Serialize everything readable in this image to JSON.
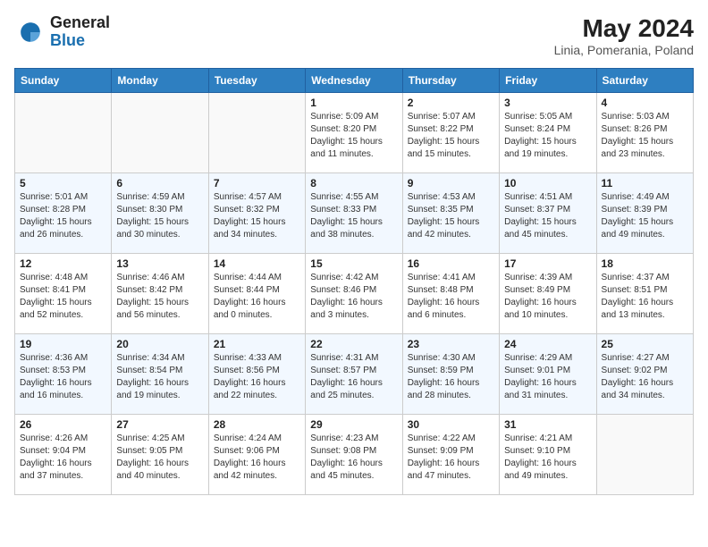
{
  "header": {
    "logo": {
      "general": "General",
      "blue": "Blue"
    },
    "title": "May 2024",
    "location": "Linia, Pomerania, Poland"
  },
  "columns": [
    "Sunday",
    "Monday",
    "Tuesday",
    "Wednesday",
    "Thursday",
    "Friday",
    "Saturday"
  ],
  "weeks": [
    [
      {
        "day": null,
        "sunrise": null,
        "sunset": null,
        "daylight": null
      },
      {
        "day": null,
        "sunrise": null,
        "sunset": null,
        "daylight": null
      },
      {
        "day": null,
        "sunrise": null,
        "sunset": null,
        "daylight": null
      },
      {
        "day": 1,
        "sunrise": "5:09 AM",
        "sunset": "8:20 PM",
        "daylight": "15 hours and 11 minutes."
      },
      {
        "day": 2,
        "sunrise": "5:07 AM",
        "sunset": "8:22 PM",
        "daylight": "15 hours and 15 minutes."
      },
      {
        "day": 3,
        "sunrise": "5:05 AM",
        "sunset": "8:24 PM",
        "daylight": "15 hours and 19 minutes."
      },
      {
        "day": 4,
        "sunrise": "5:03 AM",
        "sunset": "8:26 PM",
        "daylight": "15 hours and 23 minutes."
      }
    ],
    [
      {
        "day": 5,
        "sunrise": "5:01 AM",
        "sunset": "8:28 PM",
        "daylight": "15 hours and 26 minutes."
      },
      {
        "day": 6,
        "sunrise": "4:59 AM",
        "sunset": "8:30 PM",
        "daylight": "15 hours and 30 minutes."
      },
      {
        "day": 7,
        "sunrise": "4:57 AM",
        "sunset": "8:32 PM",
        "daylight": "15 hours and 34 minutes."
      },
      {
        "day": 8,
        "sunrise": "4:55 AM",
        "sunset": "8:33 PM",
        "daylight": "15 hours and 38 minutes."
      },
      {
        "day": 9,
        "sunrise": "4:53 AM",
        "sunset": "8:35 PM",
        "daylight": "15 hours and 42 minutes."
      },
      {
        "day": 10,
        "sunrise": "4:51 AM",
        "sunset": "8:37 PM",
        "daylight": "15 hours and 45 minutes."
      },
      {
        "day": 11,
        "sunrise": "4:49 AM",
        "sunset": "8:39 PM",
        "daylight": "15 hours and 49 minutes."
      }
    ],
    [
      {
        "day": 12,
        "sunrise": "4:48 AM",
        "sunset": "8:41 PM",
        "daylight": "15 hours and 52 minutes."
      },
      {
        "day": 13,
        "sunrise": "4:46 AM",
        "sunset": "8:42 PM",
        "daylight": "15 hours and 56 minutes."
      },
      {
        "day": 14,
        "sunrise": "4:44 AM",
        "sunset": "8:44 PM",
        "daylight": "16 hours and 0 minutes."
      },
      {
        "day": 15,
        "sunrise": "4:42 AM",
        "sunset": "8:46 PM",
        "daylight": "16 hours and 3 minutes."
      },
      {
        "day": 16,
        "sunrise": "4:41 AM",
        "sunset": "8:48 PM",
        "daylight": "16 hours and 6 minutes."
      },
      {
        "day": 17,
        "sunrise": "4:39 AM",
        "sunset": "8:49 PM",
        "daylight": "16 hours and 10 minutes."
      },
      {
        "day": 18,
        "sunrise": "4:37 AM",
        "sunset": "8:51 PM",
        "daylight": "16 hours and 13 minutes."
      }
    ],
    [
      {
        "day": 19,
        "sunrise": "4:36 AM",
        "sunset": "8:53 PM",
        "daylight": "16 hours and 16 minutes."
      },
      {
        "day": 20,
        "sunrise": "4:34 AM",
        "sunset": "8:54 PM",
        "daylight": "16 hours and 19 minutes."
      },
      {
        "day": 21,
        "sunrise": "4:33 AM",
        "sunset": "8:56 PM",
        "daylight": "16 hours and 22 minutes."
      },
      {
        "day": 22,
        "sunrise": "4:31 AM",
        "sunset": "8:57 PM",
        "daylight": "16 hours and 25 minutes."
      },
      {
        "day": 23,
        "sunrise": "4:30 AM",
        "sunset": "8:59 PM",
        "daylight": "16 hours and 28 minutes."
      },
      {
        "day": 24,
        "sunrise": "4:29 AM",
        "sunset": "9:01 PM",
        "daylight": "16 hours and 31 minutes."
      },
      {
        "day": 25,
        "sunrise": "4:27 AM",
        "sunset": "9:02 PM",
        "daylight": "16 hours and 34 minutes."
      }
    ],
    [
      {
        "day": 26,
        "sunrise": "4:26 AM",
        "sunset": "9:04 PM",
        "daylight": "16 hours and 37 minutes."
      },
      {
        "day": 27,
        "sunrise": "4:25 AM",
        "sunset": "9:05 PM",
        "daylight": "16 hours and 40 minutes."
      },
      {
        "day": 28,
        "sunrise": "4:24 AM",
        "sunset": "9:06 PM",
        "daylight": "16 hours and 42 minutes."
      },
      {
        "day": 29,
        "sunrise": "4:23 AM",
        "sunset": "9:08 PM",
        "daylight": "16 hours and 45 minutes."
      },
      {
        "day": 30,
        "sunrise": "4:22 AM",
        "sunset": "9:09 PM",
        "daylight": "16 hours and 47 minutes."
      },
      {
        "day": 31,
        "sunrise": "4:21 AM",
        "sunset": "9:10 PM",
        "daylight": "16 hours and 49 minutes."
      },
      {
        "day": null,
        "sunrise": null,
        "sunset": null,
        "daylight": null
      }
    ]
  ],
  "labels": {
    "sunrise": "Sunrise:",
    "sunset": "Sunset:",
    "daylight": "Daylight:"
  }
}
